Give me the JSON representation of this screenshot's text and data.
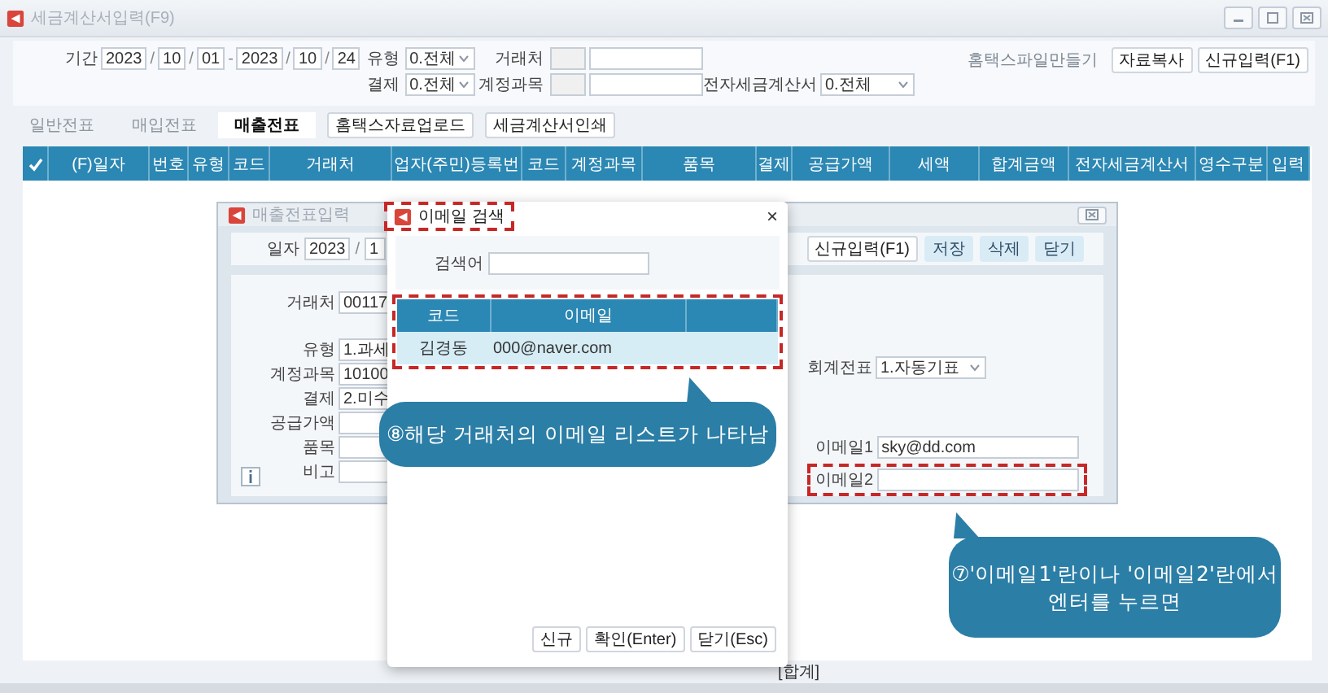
{
  "main_window": {
    "title": "세금계산서입력(F9)",
    "filters": {
      "period": {
        "label": "기간",
        "start": [
          "2023",
          "10",
          "01"
        ],
        "end": [
          "2023",
          "10",
          "24"
        ],
        "separator": "/",
        "range_separator": "-"
      },
      "selects": [
        {
          "label": "유형",
          "value": "0.전체"
        },
        {
          "label": "결제",
          "value": "0.전체"
        }
      ],
      "lookups": [
        {
          "label": "거래처"
        },
        {
          "label": "계정과목"
        }
      ],
      "e_invoice": {
        "label": "전자세금계산서",
        "value": "0.전체"
      }
    },
    "buttons": [
      {
        "label": "홈택스파일만들기",
        "disabled": true
      },
      {
        "label": "자료복사",
        "disabled": false
      },
      {
        "label": "신규입력(F1)",
        "disabled": false
      }
    ],
    "tabs": [
      {
        "label": "일반전표",
        "selected": false,
        "disabled": true
      },
      {
        "label": "매입전표",
        "selected": false,
        "disabled": true
      },
      {
        "label": "매출전표",
        "selected": true,
        "disabled": false
      }
    ],
    "tab_buttons": [
      "홈택스자료업로드",
      "세금계산서인쇄"
    ],
    "table": {
      "columns": [
        {
          "kind": "check"
        },
        {
          "kind": "text",
          "label": "(F)일자"
        },
        {
          "kind": "text",
          "label": "번호"
        },
        {
          "kind": "text",
          "label": "유형"
        },
        {
          "kind": "text",
          "label": "코드"
        },
        {
          "kind": "text",
          "label": "거래처"
        },
        {
          "kind": "text",
          "label": "업자(주민)등록번"
        },
        {
          "kind": "text",
          "label": "코드"
        },
        {
          "kind": "text",
          "label": "계정과목"
        },
        {
          "kind": "text",
          "label": "품목"
        },
        {
          "kind": "text",
          "label": "결제"
        },
        {
          "kind": "text",
          "label": "공급가액"
        },
        {
          "kind": "text",
          "label": "세액"
        },
        {
          "kind": "text",
          "label": "합계금액"
        },
        {
          "kind": "text",
          "label": "전자세금계산서"
        },
        {
          "kind": "text",
          "label": "영수구분"
        },
        {
          "kind": "text",
          "label": "입력"
        }
      ]
    },
    "total_label": "[합계]"
  },
  "sales_dialog": {
    "title": "매출전표입력",
    "date": {
      "label": "일자",
      "year": "2023",
      "separator": "/",
      "month": "1"
    },
    "buttons": [
      "신규입력(F1)",
      "저장",
      "삭제",
      "닫기"
    ],
    "fields": [
      {
        "label": "거래처",
        "value": "00117"
      },
      {
        "label": "유형",
        "value": "1.과세"
      },
      {
        "label": "계정과목",
        "value": "10100"
      },
      {
        "label": "결제",
        "value": "2.미수"
      },
      {
        "label": "공급가액"
      },
      {
        "label": "품목"
      },
      {
        "label": "비고"
      }
    ],
    "voucher": {
      "label": "회계전표",
      "value": "1.자동기표"
    },
    "email_fields": [
      {
        "label": "이메일1",
        "value": "sky@dd.com",
        "highlighted": false
      },
      {
        "label": "이메일2",
        "highlighted": true
      }
    ]
  },
  "email_dialog": {
    "title": {
      "text": "이메일 검색",
      "highlighted": true
    },
    "close": "×",
    "search": {
      "label": "검색어"
    },
    "table": {
      "highlighted": true,
      "columns": [
        "코드",
        "이메일",
        null
      ],
      "rows": [
        {
          "cells": [
            "김경동",
            "000@naver.com",
            ""
          ],
          "selected": true
        }
      ]
    },
    "buttons": [
      "신규",
      "확인(Enter)",
      "닫기(Esc)"
    ]
  },
  "callouts": [
    {
      "lines": [
        "⑧해당 거래처의 이메일 리스트가 나타남"
      ]
    },
    {
      "lines": [
        "⑦'이메일1'란이나 '이메일2'란에서",
        "엔터를 누르면"
      ]
    }
  ]
}
